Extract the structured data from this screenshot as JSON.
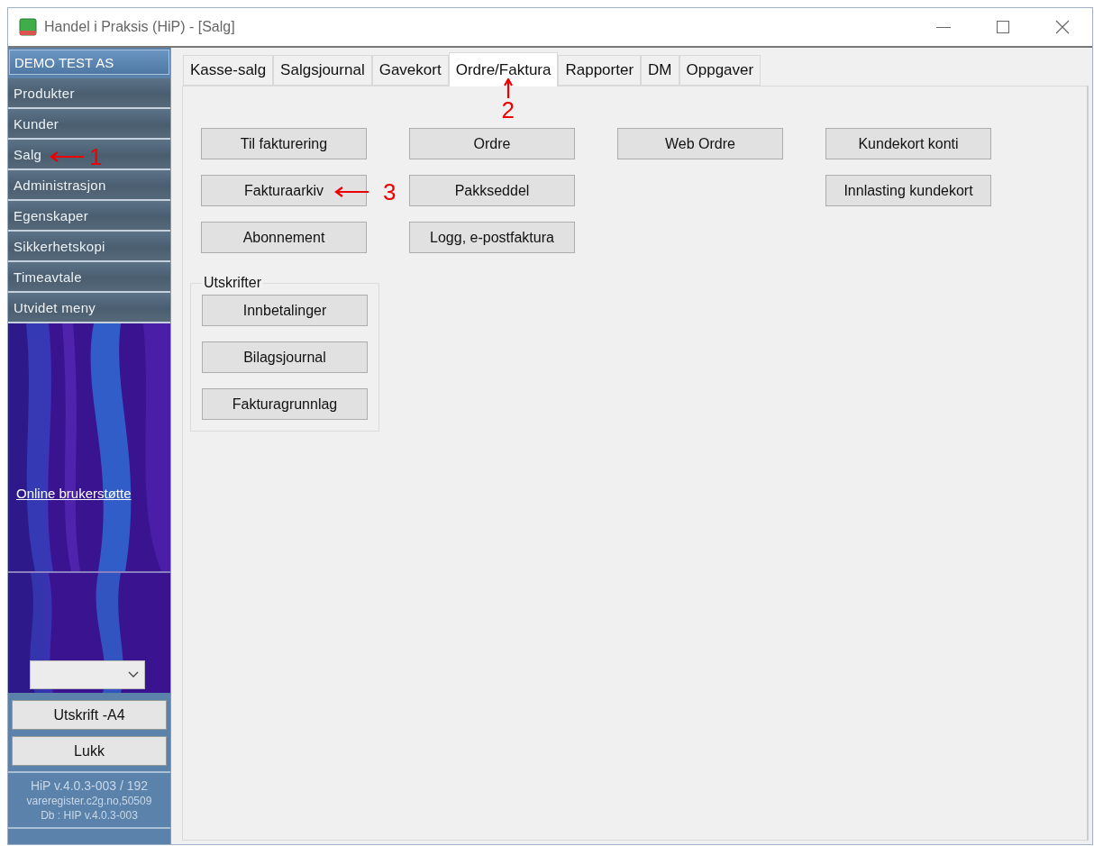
{
  "window": {
    "title": "Handel i Praksis (HiP) - [Salg]"
  },
  "sidebar": {
    "company": "DEMO TEST AS",
    "items": [
      {
        "label": "Produkter"
      },
      {
        "label": "Kunder"
      },
      {
        "label": "Salg",
        "annotation": "1"
      },
      {
        "label": "Administrasjon"
      },
      {
        "label": "Egenskaper"
      },
      {
        "label": "Sikkerhetskopi"
      },
      {
        "label": "Timeavtale"
      },
      {
        "label": "Utvidet meny"
      }
    ],
    "link": "Online brukerstøtte",
    "buttons": [
      "Utskrift -A4",
      "Lukk"
    ],
    "version_lines": [
      "HiP v.4.0.3-003 / 192",
      "vareregister.c2g.no,50509",
      "Db : HIP v.4.0.3-003"
    ]
  },
  "tabs": [
    {
      "label": "Kasse-salg",
      "selected": false
    },
    {
      "label": "Salgsjournal",
      "selected": false
    },
    {
      "label": "Gavekort",
      "selected": false
    },
    {
      "label": "Ordre/Faktura",
      "selected": true,
      "annotation": "2"
    },
    {
      "label": "Rapporter",
      "selected": false
    },
    {
      "label": "DM",
      "selected": false
    },
    {
      "label": "Oppgaver",
      "selected": false
    }
  ],
  "button_columns": [
    [
      {
        "label": "Til fakturering"
      },
      {
        "label": "Fakturaarkiv",
        "annotation": "3"
      },
      {
        "label": "Abonnement"
      }
    ],
    [
      {
        "label": "Ordre"
      },
      {
        "label": "Pakkseddel"
      },
      {
        "label": "Logg, e-postfaktura"
      }
    ],
    [
      {
        "label": "Web Ordre"
      }
    ],
    [
      {
        "label": "Kundekort konti"
      },
      {
        "label": "Innlasting kundekort"
      }
    ]
  ],
  "print_group": {
    "title": "Utskrifter",
    "buttons": [
      "Innbetalinger",
      "Bilagsjournal",
      "Fakturagrunnlag"
    ]
  }
}
